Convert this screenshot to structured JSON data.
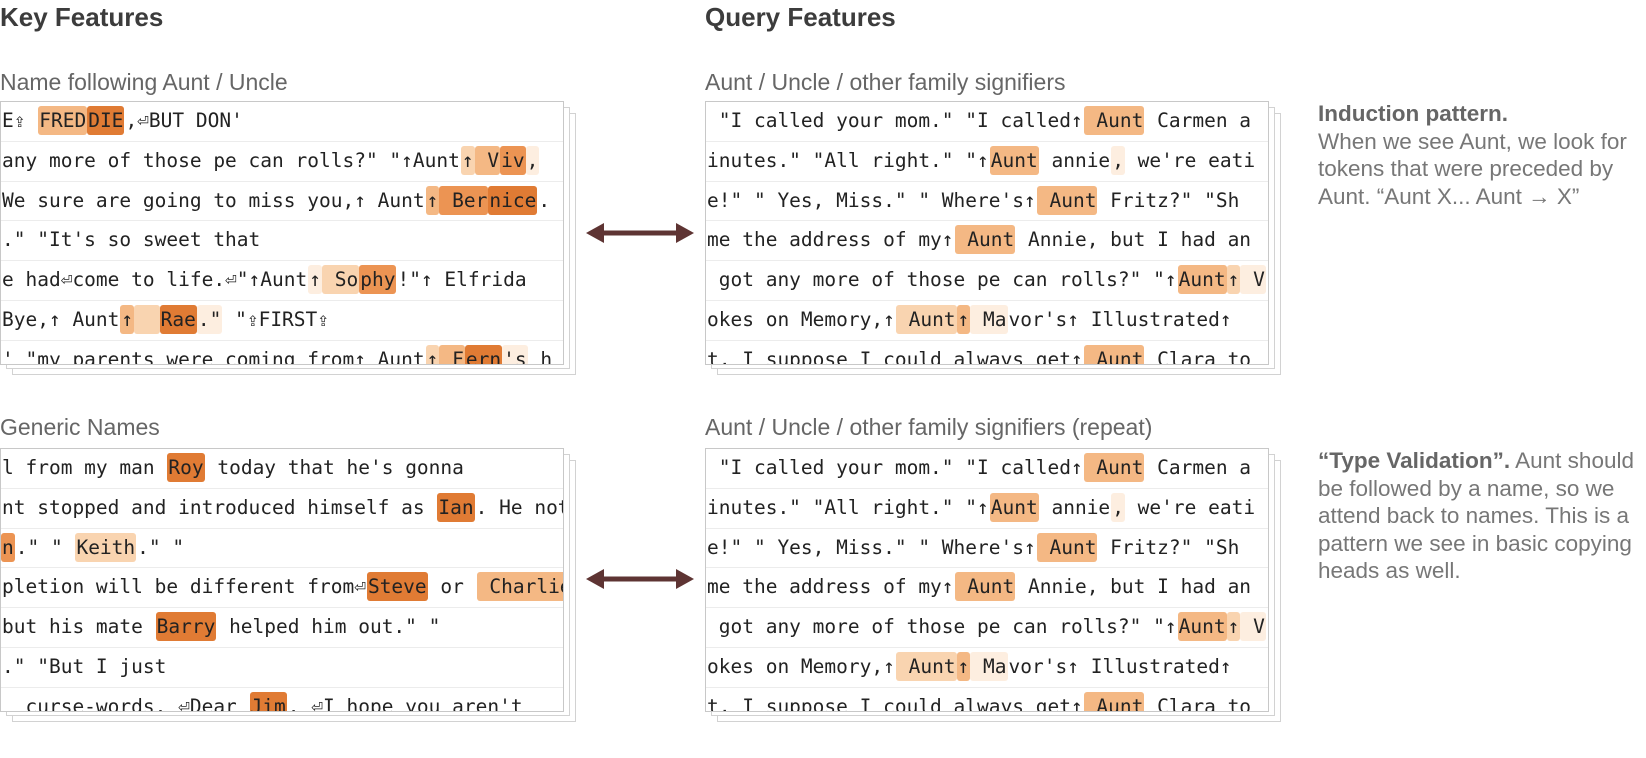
{
  "headings": {
    "key": "Key Features",
    "query": "Query Features"
  },
  "panels": {
    "key_top": {
      "subtitle": "Name following Aunt / Uncle",
      "rows": [
        [
          [
            "E⇪ ",
            0
          ],
          [
            "FRED",
            3
          ],
          [
            "DIE",
            5
          ],
          [
            ",⏎BUT DON'",
            0
          ]
        ],
        [
          [
            "any more of those pe can rolls?\" \"↑Aunt",
            0
          ],
          [
            "↑",
            2
          ],
          [
            " V",
            3
          ],
          [
            "iv",
            4
          ],
          [
            ",",
            1
          ]
        ],
        [
          [
            "We sure are going to miss you,↑ Aunt",
            0
          ],
          [
            "↑",
            3
          ],
          [
            " Ber",
            4
          ],
          [
            "nice",
            5
          ],
          [
            ".",
            0
          ]
        ],
        [
          [
            ".\" \"It's so sweet that",
            0
          ]
        ],
        [
          [
            "e had⏎come to life.⏎\"↑Aunt",
            0
          ],
          [
            "↑",
            1
          ],
          [
            " So",
            2
          ],
          [
            "phy",
            4
          ],
          [
            "!\"↑ Elfrida",
            0
          ]
        ],
        [
          [
            "Bye,↑ Aunt",
            0
          ],
          [
            "↑",
            3
          ],
          [
            "  ",
            2
          ],
          [
            "Rae",
            5
          ],
          [
            ".\"",
            1
          ],
          [
            " \"⇪FIRST⇪",
            0
          ]
        ],
        [
          [
            "' \"my parents were coming from↑ Aunt",
            0
          ],
          [
            "↑",
            2
          ],
          [
            " F",
            3
          ],
          [
            "ern",
            5
          ],
          [
            "'s",
            1
          ],
          [
            " h",
            0
          ]
        ]
      ]
    },
    "key_bottom": {
      "subtitle": "Generic Names",
      "rows": [
        [
          [
            "l from my man ",
            0
          ],
          [
            "Roy",
            5
          ],
          [
            " today that he's gonna",
            0
          ]
        ],
        [
          [
            "nt stopped and introduced himself as ",
            0
          ],
          [
            "Ian",
            5
          ],
          [
            ". He not",
            0
          ]
        ],
        [
          [
            "n",
            4
          ],
          [
            ".\" \" ",
            0
          ],
          [
            "Keith",
            2
          ],
          [
            ".\" \"",
            0
          ]
        ],
        [
          [
            "pletion will be different from⏎",
            0
          ],
          [
            "Steve",
            5
          ],
          [
            " or ",
            0
          ],
          [
            " Charlie",
            3
          ],
          [
            "'",
            0
          ]
        ],
        [
          [
            "but his mate ",
            0
          ],
          [
            "Barry",
            5
          ],
          [
            " helped him out.\" \"",
            0
          ]
        ],
        [
          [
            ".\" \"But I just",
            0
          ]
        ],
        [
          [
            "  curse-words. ⏎Dear ",
            0
          ],
          [
            "Jim",
            5
          ],
          [
            ". ⏎I hope you aren't",
            0
          ]
        ]
      ]
    },
    "query_top": {
      "subtitle": "Aunt / Uncle / other family signifiers",
      "rows": [
        [
          [
            " \"I called your mom.\" \"I called↑",
            0
          ],
          [
            " Aunt",
            3
          ],
          [
            " Carmen a",
            0
          ]
        ],
        [
          [
            "inutes.\" \"All right.\" \"↑",
            0
          ],
          [
            "Aunt",
            3
          ],
          [
            " annie",
            0
          ],
          [
            ",",
            1
          ],
          [
            " we're eati",
            0
          ]
        ],
        [
          [
            "e!\" \" Yes, Miss.\" \" Where's↑",
            0
          ],
          [
            " Aunt",
            3
          ],
          [
            " Fritz?\" \"Sh",
            0
          ]
        ],
        [
          [
            "me the address of my↑",
            0
          ],
          [
            " Aunt",
            3
          ],
          [
            " Annie, but I had an",
            0
          ]
        ],
        [
          [
            " got any more of those pe can rolls?\" \"↑",
            0
          ],
          [
            "Aunt",
            3
          ],
          [
            "↑",
            2
          ],
          [
            " V",
            1
          ]
        ],
        [
          [
            "okes on Memory,↑",
            0
          ],
          [
            " Aunt",
            2
          ],
          [
            "↑",
            3
          ],
          [
            " Ma",
            1
          ],
          [
            "vor's↑ Illustrated↑",
            0
          ]
        ],
        [
          [
            "t, I suppose I could always get↑",
            0
          ],
          [
            " Aunt",
            3
          ],
          [
            " Clara to",
            0
          ]
        ]
      ]
    },
    "query_bottom": {
      "subtitle": "Aunt / Uncle / other family signifiers (repeat)",
      "rows": [
        [
          [
            " \"I called your mom.\" \"I called↑",
            0
          ],
          [
            " Aunt",
            3
          ],
          [
            " Carmen a",
            0
          ]
        ],
        [
          [
            "inutes.\" \"All right.\" \"↑",
            0
          ],
          [
            "Aunt",
            3
          ],
          [
            " annie",
            0
          ],
          [
            ",",
            1
          ],
          [
            " we're eati",
            0
          ]
        ],
        [
          [
            "e!\" \" Yes, Miss.\" \" Where's↑",
            0
          ],
          [
            " Aunt",
            3
          ],
          [
            " Fritz?\" \"Sh",
            0
          ]
        ],
        [
          [
            "me the address of my↑",
            0
          ],
          [
            " Aunt",
            3
          ],
          [
            " Annie, but I had an",
            0
          ]
        ],
        [
          [
            " got any more of those pe can rolls?\" \"↑",
            0
          ],
          [
            "Aunt",
            3
          ],
          [
            "↑",
            2
          ],
          [
            " V",
            1
          ]
        ],
        [
          [
            "okes on Memory,↑",
            0
          ],
          [
            " Aunt",
            2
          ],
          [
            "↑",
            3
          ],
          [
            " Ma",
            1
          ],
          [
            "vor's↑ Illustrated↑",
            0
          ]
        ],
        [
          [
            "t, I suppose I could always get↑",
            0
          ],
          [
            " Aunt",
            3
          ],
          [
            " Clara to",
            0
          ]
        ]
      ]
    }
  },
  "notes": {
    "induction": {
      "title": "Induction pattern.",
      "body": "When we see Aunt, we look for tokens that were preceded by Aunt. “Aunt X... Aunt → X”"
    },
    "type_validation": {
      "title": "“Type Validation”.",
      "body": "Aunt should be followed by a name, so we attend back to names. This is a pattern we see in basic copying heads as well."
    }
  },
  "colors": {
    "arrow": "#5e3433",
    "highlight_levels": [
      "#fdeee0",
      "#f9d4b0",
      "#f4b884",
      "#ec9453",
      "#e07b34"
    ]
  }
}
